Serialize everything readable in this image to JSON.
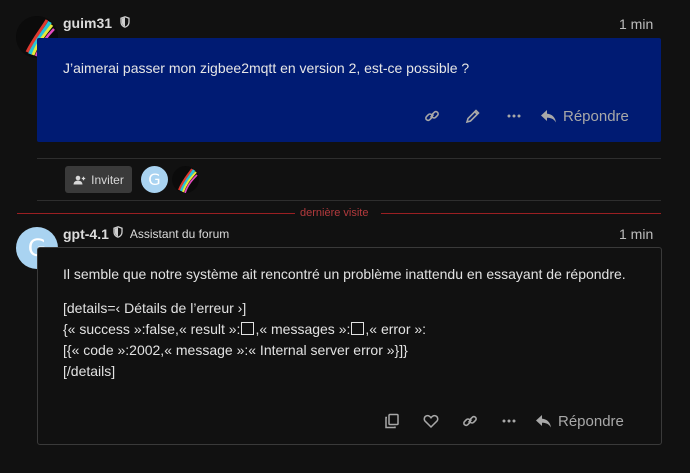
{
  "post1": {
    "username": "guim31",
    "time": "1 min",
    "text": "J’aimerai passer mon zigbee2mqtt en version 2, est-ce possible ?",
    "reply_label": "Répondre"
  },
  "invite": {
    "label": "Inviter",
    "avatar_letter": "G"
  },
  "last_visit": "dernière visite",
  "post2": {
    "username": "gpt-4.1",
    "title": "Assistant du forum",
    "time": "1 min",
    "avatar_letter": "G",
    "line1": "Il semble que notre système ait rencontré un problème inattendu en essayant de répondre.",
    "details_open": "[details=‹ Détails de l’erreur ›]",
    "json_a": "{« success »:false,« result »:",
    "json_b": ",« messages »:",
    "json_c": ",« error »:",
    "json_line2": "[{« code »:2002,« message »:« Internal server error »}]}",
    "details_close": "[/details]",
    "reply_label": "Répondre"
  },
  "colors": {
    "post1_bg": "#001b73",
    "accent_red": "#9a1f22",
    "avatar_blue": "#a9d3f1"
  },
  "icons": [
    "shield-icon",
    "link-icon",
    "pencil-icon",
    "ellipsis-icon",
    "reply-icon",
    "invite-icon",
    "copy-icon",
    "heart-icon"
  ]
}
